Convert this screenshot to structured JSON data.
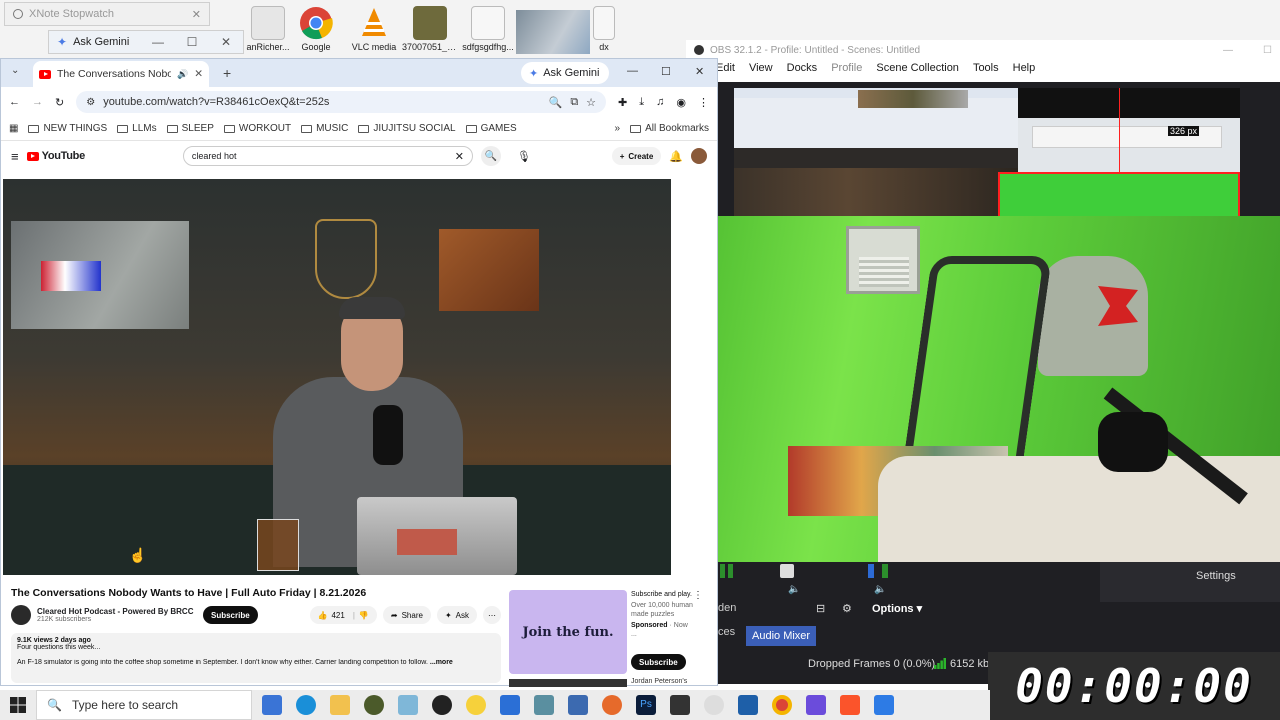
{
  "colors": {
    "yt_red": "#ff0000",
    "obs_dark": "#1f1f23",
    "greenscreen": "#5fd13b",
    "chrome_tab": "#dfe8f5",
    "taskbar": "#ececec"
  },
  "desktop": {
    "icons": [
      {
        "label": "anRicher...",
        "icon": "file-icon"
      },
      {
        "label": "Google",
        "icon": "chrome-icon"
      },
      {
        "label": "VLC media",
        "icon": "vlc-icon"
      },
      {
        "label": "37007051_6...",
        "icon": "image-icon"
      },
      {
        "label": "sdfgsgdfhg...",
        "icon": "file-icon"
      },
      {
        "label": "dx",
        "icon": "file-icon"
      }
    ]
  },
  "xnote": {
    "title": "XNote Stopwatch"
  },
  "gemini_bar": {
    "label": "Ask Gemini"
  },
  "chrome": {
    "tab_title": "The Conversations Nobody",
    "new_tab": "+",
    "gemini": "Ask Gemini",
    "url": "youtube.com/watch?v=R38461cOexQ&t=252s",
    "bookmarks": [
      "NEW THINGS",
      "LLMs",
      "SLEEP",
      "WORKOUT",
      "MUSIC",
      "JIUJITSU SOCIAL",
      "GAMES"
    ],
    "all_bookmarks": "All Bookmarks",
    "more": "»"
  },
  "youtube": {
    "logo": "YouTube",
    "search_value": "cleared hot",
    "create": "Create",
    "video_title": "The Conversations Nobody Wants to Have | Full Auto Friday | 8.21.2026",
    "channel": "Cleared Hot Podcast - Powered By BRCC",
    "subscribers": "212K subscribers",
    "subscribe": "Subscribe",
    "likes": "421",
    "share": "Share",
    "ask": "Ask",
    "views": "9.1K views  2 days ago",
    "desc_line1": "Four questions this week...",
    "desc_line2": "An F-18 simulator is going into the coffee shop sometime in September. I don't know why either. Carrier landing competition to follow.",
    "desc_more": "...more",
    "ad": {
      "image_text": "Join the fun.",
      "title": "Subscribe and play.",
      "body": "Over 10,000 human made puzzles",
      "sponsored": "Sponsored",
      "sponsored_suffix": "· Now ...",
      "button": "Subscribe"
    },
    "next_video_channel": "Jordan Peterson's"
  },
  "obs": {
    "title": "OBS 32.1.2 - Profile: Untitled - Scenes: Untitled",
    "menu": [
      "Edit",
      "View",
      "Docks",
      "Profile",
      "Scene Collection",
      "Tools",
      "Help"
    ],
    "settings": "Settings",
    "options": "Options",
    "sources_tab": "ces",
    "hidden_tab": "den",
    "audio_mixer": "Audio Mixer",
    "dropped_frames": "Dropped Frames 0 (0.0%)",
    "kbps": "6152 kb",
    "preview_size": "326 px"
  },
  "timer": {
    "value": "00:00:00"
  },
  "taskbar": {
    "search_placeholder": "Type here to search"
  }
}
